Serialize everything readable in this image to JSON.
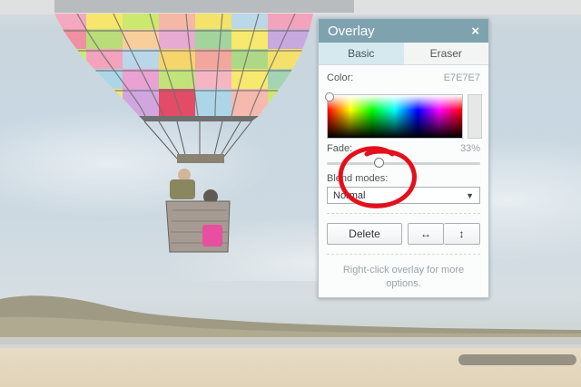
{
  "overlay_panel": {
    "title": "Overlay",
    "close_symbol": "×",
    "tabs": [
      {
        "label": "Basic",
        "active": true
      },
      {
        "label": "Eraser",
        "active": false
      }
    ],
    "color_label": "Color:",
    "color_value": "E7E7E7",
    "color_hex": "#E7E7E7",
    "fade_label": "Fade:",
    "fade_value": "33%",
    "fade_fraction": 0.33,
    "blend_label": "Blend modes:",
    "blend_selected": "Normal",
    "delete_label": "Delete",
    "flip_horizontal_symbol": "↔",
    "flip_vertical_symbol": "↕",
    "hint_line1": "Right-click overlay for more",
    "hint_line2": "options."
  },
  "icons": [
    "close-icon",
    "chevron-down-icon",
    "flip-horizontal-icon",
    "flip-vertical-icon"
  ],
  "colors": {
    "header": "#7fa3ae",
    "active_tab": "#d6e9ef",
    "annotation": "#e3101c"
  }
}
